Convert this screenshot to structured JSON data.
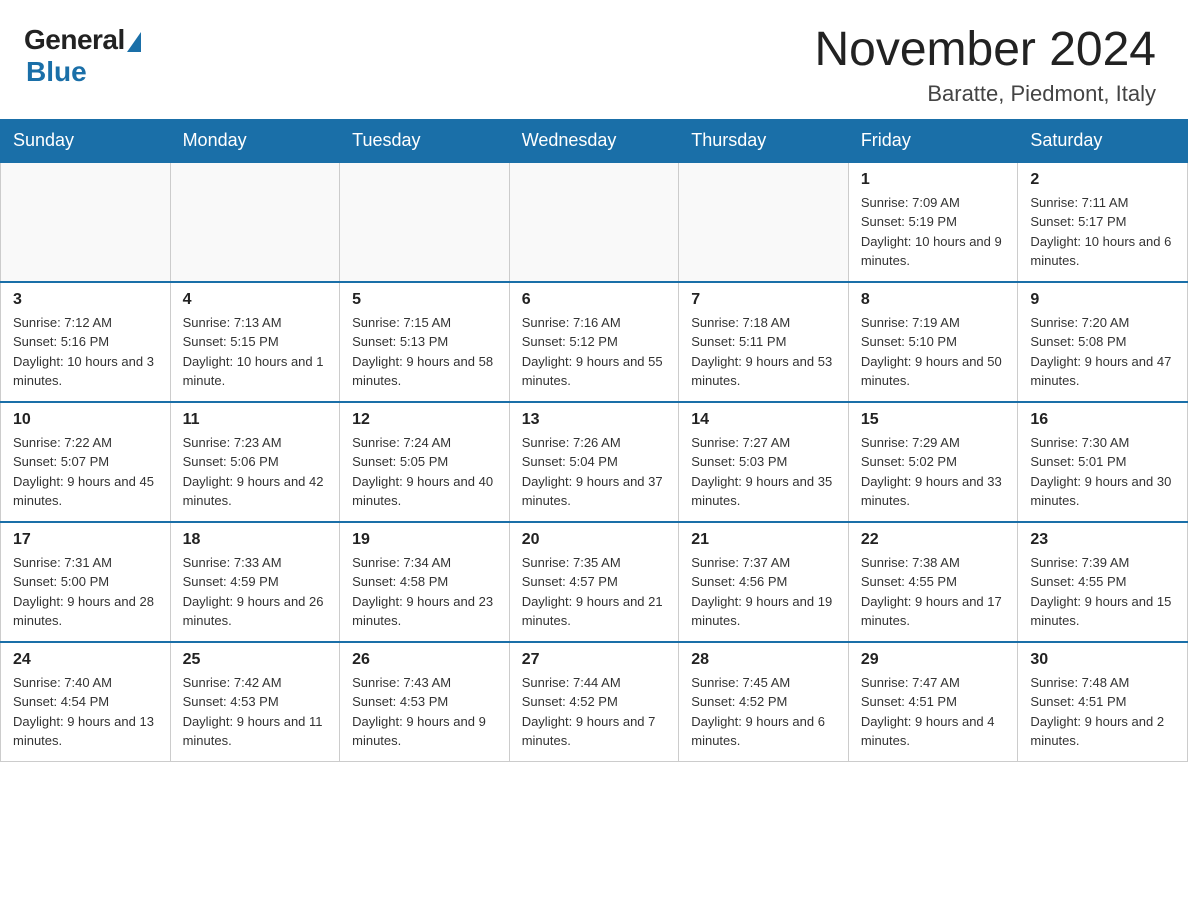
{
  "header": {
    "logo_general": "General",
    "logo_blue": "Blue",
    "month_year": "November 2024",
    "location": "Baratte, Piedmont, Italy"
  },
  "weekdays": [
    "Sunday",
    "Monday",
    "Tuesday",
    "Wednesday",
    "Thursday",
    "Friday",
    "Saturday"
  ],
  "weeks": [
    [
      {
        "day": "",
        "sunrise": "",
        "sunset": "",
        "daylight": ""
      },
      {
        "day": "",
        "sunrise": "",
        "sunset": "",
        "daylight": ""
      },
      {
        "day": "",
        "sunrise": "",
        "sunset": "",
        "daylight": ""
      },
      {
        "day": "",
        "sunrise": "",
        "sunset": "",
        "daylight": ""
      },
      {
        "day": "",
        "sunrise": "",
        "sunset": "",
        "daylight": ""
      },
      {
        "day": "1",
        "sunrise": "Sunrise: 7:09 AM",
        "sunset": "Sunset: 5:19 PM",
        "daylight": "Daylight: 10 hours and 9 minutes."
      },
      {
        "day": "2",
        "sunrise": "Sunrise: 7:11 AM",
        "sunset": "Sunset: 5:17 PM",
        "daylight": "Daylight: 10 hours and 6 minutes."
      }
    ],
    [
      {
        "day": "3",
        "sunrise": "Sunrise: 7:12 AM",
        "sunset": "Sunset: 5:16 PM",
        "daylight": "Daylight: 10 hours and 3 minutes."
      },
      {
        "day": "4",
        "sunrise": "Sunrise: 7:13 AM",
        "sunset": "Sunset: 5:15 PM",
        "daylight": "Daylight: 10 hours and 1 minute."
      },
      {
        "day": "5",
        "sunrise": "Sunrise: 7:15 AM",
        "sunset": "Sunset: 5:13 PM",
        "daylight": "Daylight: 9 hours and 58 minutes."
      },
      {
        "day": "6",
        "sunrise": "Sunrise: 7:16 AM",
        "sunset": "Sunset: 5:12 PM",
        "daylight": "Daylight: 9 hours and 55 minutes."
      },
      {
        "day": "7",
        "sunrise": "Sunrise: 7:18 AM",
        "sunset": "Sunset: 5:11 PM",
        "daylight": "Daylight: 9 hours and 53 minutes."
      },
      {
        "day": "8",
        "sunrise": "Sunrise: 7:19 AM",
        "sunset": "Sunset: 5:10 PM",
        "daylight": "Daylight: 9 hours and 50 minutes."
      },
      {
        "day": "9",
        "sunrise": "Sunrise: 7:20 AM",
        "sunset": "Sunset: 5:08 PM",
        "daylight": "Daylight: 9 hours and 47 minutes."
      }
    ],
    [
      {
        "day": "10",
        "sunrise": "Sunrise: 7:22 AM",
        "sunset": "Sunset: 5:07 PM",
        "daylight": "Daylight: 9 hours and 45 minutes."
      },
      {
        "day": "11",
        "sunrise": "Sunrise: 7:23 AM",
        "sunset": "Sunset: 5:06 PM",
        "daylight": "Daylight: 9 hours and 42 minutes."
      },
      {
        "day": "12",
        "sunrise": "Sunrise: 7:24 AM",
        "sunset": "Sunset: 5:05 PM",
        "daylight": "Daylight: 9 hours and 40 minutes."
      },
      {
        "day": "13",
        "sunrise": "Sunrise: 7:26 AM",
        "sunset": "Sunset: 5:04 PM",
        "daylight": "Daylight: 9 hours and 37 minutes."
      },
      {
        "day": "14",
        "sunrise": "Sunrise: 7:27 AM",
        "sunset": "Sunset: 5:03 PM",
        "daylight": "Daylight: 9 hours and 35 minutes."
      },
      {
        "day": "15",
        "sunrise": "Sunrise: 7:29 AM",
        "sunset": "Sunset: 5:02 PM",
        "daylight": "Daylight: 9 hours and 33 minutes."
      },
      {
        "day": "16",
        "sunrise": "Sunrise: 7:30 AM",
        "sunset": "Sunset: 5:01 PM",
        "daylight": "Daylight: 9 hours and 30 minutes."
      }
    ],
    [
      {
        "day": "17",
        "sunrise": "Sunrise: 7:31 AM",
        "sunset": "Sunset: 5:00 PM",
        "daylight": "Daylight: 9 hours and 28 minutes."
      },
      {
        "day": "18",
        "sunrise": "Sunrise: 7:33 AM",
        "sunset": "Sunset: 4:59 PM",
        "daylight": "Daylight: 9 hours and 26 minutes."
      },
      {
        "day": "19",
        "sunrise": "Sunrise: 7:34 AM",
        "sunset": "Sunset: 4:58 PM",
        "daylight": "Daylight: 9 hours and 23 minutes."
      },
      {
        "day": "20",
        "sunrise": "Sunrise: 7:35 AM",
        "sunset": "Sunset: 4:57 PM",
        "daylight": "Daylight: 9 hours and 21 minutes."
      },
      {
        "day": "21",
        "sunrise": "Sunrise: 7:37 AM",
        "sunset": "Sunset: 4:56 PM",
        "daylight": "Daylight: 9 hours and 19 minutes."
      },
      {
        "day": "22",
        "sunrise": "Sunrise: 7:38 AM",
        "sunset": "Sunset: 4:55 PM",
        "daylight": "Daylight: 9 hours and 17 minutes."
      },
      {
        "day": "23",
        "sunrise": "Sunrise: 7:39 AM",
        "sunset": "Sunset: 4:55 PM",
        "daylight": "Daylight: 9 hours and 15 minutes."
      }
    ],
    [
      {
        "day": "24",
        "sunrise": "Sunrise: 7:40 AM",
        "sunset": "Sunset: 4:54 PM",
        "daylight": "Daylight: 9 hours and 13 minutes."
      },
      {
        "day": "25",
        "sunrise": "Sunrise: 7:42 AM",
        "sunset": "Sunset: 4:53 PM",
        "daylight": "Daylight: 9 hours and 11 minutes."
      },
      {
        "day": "26",
        "sunrise": "Sunrise: 7:43 AM",
        "sunset": "Sunset: 4:53 PM",
        "daylight": "Daylight: 9 hours and 9 minutes."
      },
      {
        "day": "27",
        "sunrise": "Sunrise: 7:44 AM",
        "sunset": "Sunset: 4:52 PM",
        "daylight": "Daylight: 9 hours and 7 minutes."
      },
      {
        "day": "28",
        "sunrise": "Sunrise: 7:45 AM",
        "sunset": "Sunset: 4:52 PM",
        "daylight": "Daylight: 9 hours and 6 minutes."
      },
      {
        "day": "29",
        "sunrise": "Sunrise: 7:47 AM",
        "sunset": "Sunset: 4:51 PM",
        "daylight": "Daylight: 9 hours and 4 minutes."
      },
      {
        "day": "30",
        "sunrise": "Sunrise: 7:48 AM",
        "sunset": "Sunset: 4:51 PM",
        "daylight": "Daylight: 9 hours and 2 minutes."
      }
    ]
  ]
}
